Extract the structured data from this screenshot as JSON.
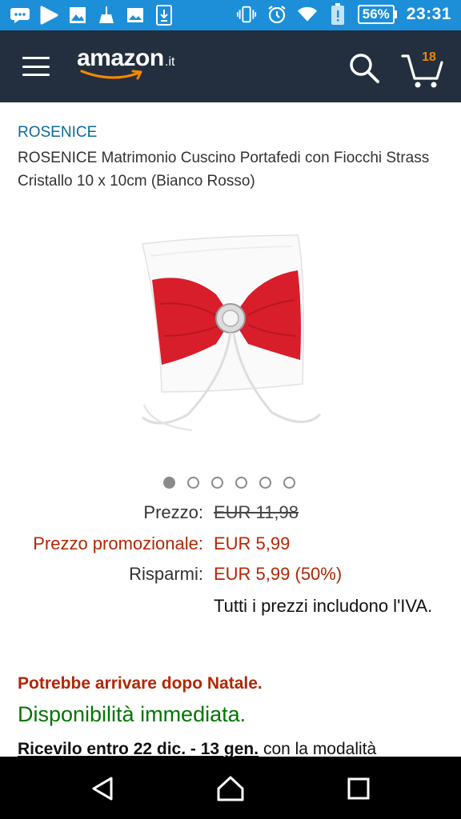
{
  "status_bar": {
    "battery": "56%",
    "time": "23:31"
  },
  "header": {
    "logo_text": "amazon",
    "logo_tld": ".it",
    "cart_count": "18"
  },
  "product": {
    "brand": "ROSENICE",
    "title": "ROSENICE Matrimonio Cuscino Portafedi con Fiocchi Strass Cristallo 10 x 10cm (Bianco Rosso)",
    "image_count": 6,
    "active_image": 1
  },
  "pricing": {
    "list_label": "Prezzo:",
    "list_value": "EUR 11,98",
    "promo_label": "Prezzo promozionale:",
    "promo_value": "EUR 5,99",
    "saving_label": "Risparmi:",
    "saving_value": "EUR 5,99 (50%)",
    "vat_note": "Tutti i prezzi includono l'IVA."
  },
  "shipping": {
    "warning": "Potrebbe arrivare dopo Natale.",
    "availability": "Disponibilità immediata.",
    "receive_dates": "Ricevilo entro 22 dic. - 13 gen.",
    "receive_suffix": " con la modalità"
  },
  "colors": {
    "status_bar": "#1d8fd8",
    "header": "#232f3e",
    "brand_link": "#0a6b9a",
    "promo": "#b12704",
    "availability": "#007600"
  },
  "icons": {
    "status_left": [
      "chat-icon",
      "play-icon",
      "image-icon",
      "broom-icon",
      "photo-icon",
      "download-icon"
    ],
    "status_right": [
      "vibrate-icon",
      "alarm-icon",
      "wifi-icon",
      "battery-alert-icon",
      "battery-icon"
    ],
    "nav": [
      "back-icon",
      "home-icon",
      "recents-icon"
    ]
  }
}
